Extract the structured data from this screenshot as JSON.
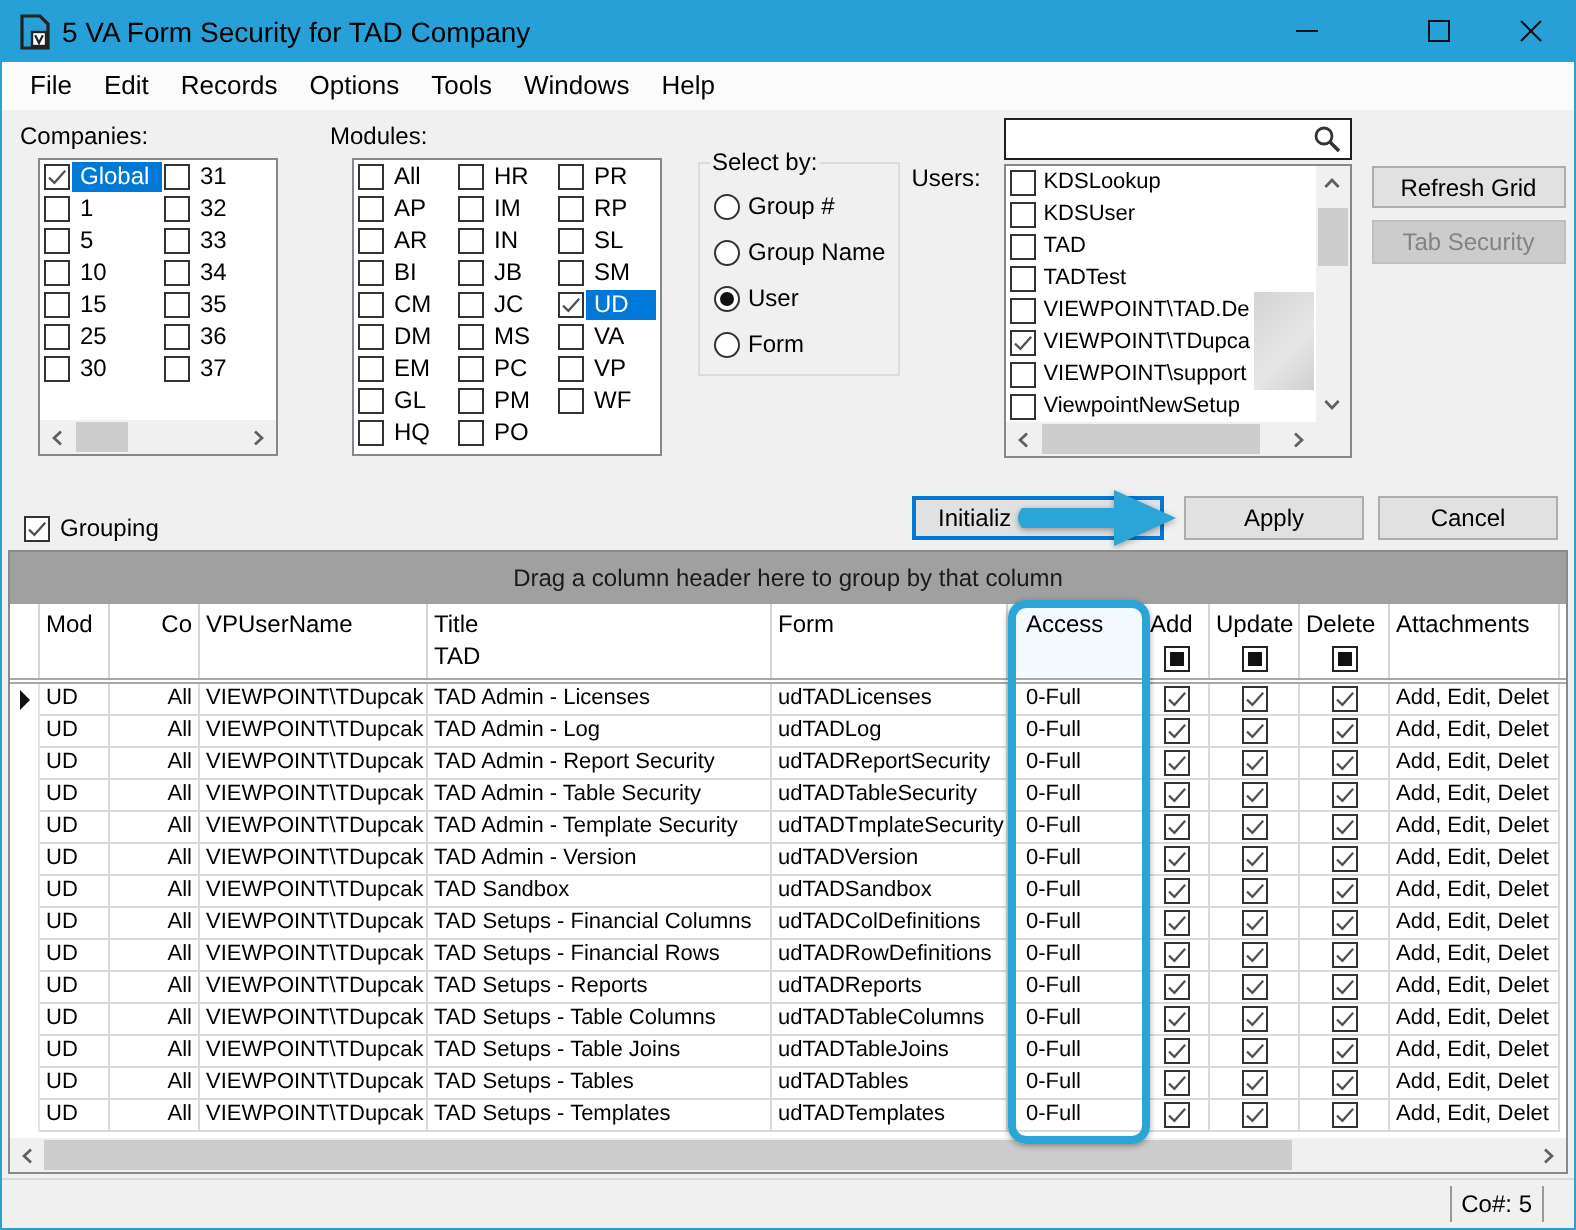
{
  "window": {
    "title": "5 VA Form Security for TAD Company"
  },
  "menu": [
    "File",
    "Edit",
    "Records",
    "Options",
    "Tools",
    "Windows",
    "Help"
  ],
  "companies": {
    "label": "Companies:",
    "items": [
      {
        "label": "Global",
        "checked": true,
        "selected": true
      },
      {
        "label": "1",
        "checked": false,
        "selected": false
      },
      {
        "label": "5",
        "checked": false,
        "selected": false
      },
      {
        "label": "10",
        "checked": false,
        "selected": false
      },
      {
        "label": "15",
        "checked": false,
        "selected": false
      },
      {
        "label": "25",
        "checked": false,
        "selected": false
      },
      {
        "label": "30",
        "checked": false,
        "selected": false
      },
      {
        "label": "31",
        "checked": false,
        "selected": false
      },
      {
        "label": "32",
        "checked": false,
        "selected": false
      },
      {
        "label": "33",
        "checked": false,
        "selected": false
      },
      {
        "label": "34",
        "checked": false,
        "selected": false
      },
      {
        "label": "35",
        "checked": false,
        "selected": false
      },
      {
        "label": "36",
        "checked": false,
        "selected": false
      },
      {
        "label": "37",
        "checked": false,
        "selected": false
      }
    ]
  },
  "modules": {
    "label": "Modules:",
    "items": [
      {
        "label": "All",
        "checked": false,
        "selected": false
      },
      {
        "label": "AP",
        "checked": false,
        "selected": false
      },
      {
        "label": "AR",
        "checked": false,
        "selected": false
      },
      {
        "label": "BI",
        "checked": false,
        "selected": false
      },
      {
        "label": "CM",
        "checked": false,
        "selected": false
      },
      {
        "label": "DM",
        "checked": false,
        "selected": false
      },
      {
        "label": "EM",
        "checked": false,
        "selected": false
      },
      {
        "label": "GL",
        "checked": false,
        "selected": false
      },
      {
        "label": "HQ",
        "checked": false,
        "selected": false
      },
      {
        "label": "HR",
        "checked": false,
        "selected": false
      },
      {
        "label": "IM",
        "checked": false,
        "selected": false
      },
      {
        "label": "IN",
        "checked": false,
        "selected": false
      },
      {
        "label": "JB",
        "checked": false,
        "selected": false
      },
      {
        "label": "JC",
        "checked": false,
        "selected": false
      },
      {
        "label": "MS",
        "checked": false,
        "selected": false
      },
      {
        "label": "PC",
        "checked": false,
        "selected": false
      },
      {
        "label": "PM",
        "checked": false,
        "selected": false
      },
      {
        "label": "PO",
        "checked": false,
        "selected": false
      },
      {
        "label": "PR",
        "checked": false,
        "selected": false
      },
      {
        "label": "RP",
        "checked": false,
        "selected": false
      },
      {
        "label": "SL",
        "checked": false,
        "selected": false
      },
      {
        "label": "SM",
        "checked": false,
        "selected": false
      },
      {
        "label": "UD",
        "checked": true,
        "selected": true
      },
      {
        "label": "VA",
        "checked": false,
        "selected": false
      },
      {
        "label": "VP",
        "checked": false,
        "selected": false
      },
      {
        "label": "WF",
        "checked": false,
        "selected": false
      }
    ]
  },
  "select_by": {
    "label": "Select by:",
    "options": [
      {
        "label": "Group #",
        "selected": false
      },
      {
        "label": "Group Name",
        "selected": false
      },
      {
        "label": "User",
        "selected": true
      },
      {
        "label": "Form",
        "selected": false
      }
    ]
  },
  "users": {
    "label": "Users:",
    "items": [
      {
        "label": "KDSLookup",
        "checked": false
      },
      {
        "label": "KDSUser",
        "checked": false
      },
      {
        "label": "TAD",
        "checked": false
      },
      {
        "label": "TADTest",
        "checked": false
      },
      {
        "label": "VIEWPOINT\\TAD.De",
        "checked": false
      },
      {
        "label": "VIEWPOINT\\TDupca",
        "checked": true
      },
      {
        "label": "VIEWPOINT\\support",
        "checked": false
      },
      {
        "label": "ViewpointNewSetup",
        "checked": false
      }
    ]
  },
  "side_buttons": [
    {
      "label": "Refresh Grid",
      "disabled": false
    },
    {
      "label": "Tab Security",
      "disabled": true
    }
  ],
  "grouping": {
    "label": "Grouping",
    "checked": true
  },
  "actions": [
    {
      "label": "Initializ",
      "focused": true
    },
    {
      "label": "Apply",
      "focused": false
    },
    {
      "label": "Cancel",
      "focused": false
    }
  ],
  "grid": {
    "group_panel": "Drag a column header here to group by that column",
    "columns": [
      {
        "label": "Mod",
        "kind": "text",
        "highlighted": false
      },
      {
        "label": "Co",
        "kind": "numeric",
        "highlighted": false
      },
      {
        "label": "VPUserName",
        "kind": "text",
        "highlighted": false
      },
      {
        "label": "Title",
        "kind": "text",
        "filter": "TAD",
        "highlighted": false
      },
      {
        "label": "Form",
        "kind": "text",
        "highlighted": false
      },
      {
        "label": "Access",
        "kind": "text",
        "highlighted": true
      },
      {
        "label": "Add",
        "kind": "check",
        "indeterminate": true,
        "highlighted": false
      },
      {
        "label": "Update",
        "kind": "check",
        "indeterminate": true,
        "highlighted": false
      },
      {
        "label": "Delete",
        "kind": "check",
        "indeterminate": true,
        "highlighted": false
      },
      {
        "label": "Attachments",
        "kind": "text",
        "highlighted": false
      }
    ],
    "rows": [
      {
        "current": true,
        "cells": [
          "UD",
          "All",
          "VIEWPOINT\\TDupcak",
          "TAD Admin - Licenses",
          "udTADLicenses",
          "0-Full",
          {
            "checked": true
          },
          {
            "checked": true
          },
          {
            "checked": true
          },
          "Add, Edit, Delet"
        ]
      },
      {
        "current": false,
        "cells": [
          "UD",
          "All",
          "VIEWPOINT\\TDupcak",
          "TAD Admin - Log",
          "udTADLog",
          "0-Full",
          {
            "checked": true
          },
          {
            "checked": true
          },
          {
            "checked": true
          },
          "Add, Edit, Delet"
        ]
      },
      {
        "current": false,
        "cells": [
          "UD",
          "All",
          "VIEWPOINT\\TDupcak",
          "TAD Admin - Report Security",
          "udTADReportSecurity",
          "0-Full",
          {
            "checked": true
          },
          {
            "checked": true
          },
          {
            "checked": true
          },
          "Add, Edit, Delet"
        ]
      },
      {
        "current": false,
        "cells": [
          "UD",
          "All",
          "VIEWPOINT\\TDupcak",
          "TAD Admin - Table Security",
          "udTADTableSecurity",
          "0-Full",
          {
            "checked": true
          },
          {
            "checked": true
          },
          {
            "checked": true
          },
          "Add, Edit, Delet"
        ]
      },
      {
        "current": false,
        "cells": [
          "UD",
          "All",
          "VIEWPOINT\\TDupcak",
          "TAD Admin - Template Security",
          "udTADTmplateSecurity",
          "0-Full",
          {
            "checked": true
          },
          {
            "checked": true
          },
          {
            "checked": true
          },
          "Add, Edit, Delet"
        ]
      },
      {
        "current": false,
        "cells": [
          "UD",
          "All",
          "VIEWPOINT\\TDupcak",
          "TAD Admin - Version",
          "udTADVersion",
          "0-Full",
          {
            "checked": true
          },
          {
            "checked": true
          },
          {
            "checked": true
          },
          "Add, Edit, Delet"
        ]
      },
      {
        "current": false,
        "cells": [
          "UD",
          "All",
          "VIEWPOINT\\TDupcak",
          "TAD Sandbox",
          "udTADSandbox",
          "0-Full",
          {
            "checked": true
          },
          {
            "checked": true
          },
          {
            "checked": true
          },
          "Add, Edit, Delet"
        ]
      },
      {
        "current": false,
        "cells": [
          "UD",
          "All",
          "VIEWPOINT\\TDupcak",
          "TAD Setups - Financial Columns",
          "udTADColDefinitions",
          "0-Full",
          {
            "checked": true
          },
          {
            "checked": true
          },
          {
            "checked": true
          },
          "Add, Edit, Delet"
        ]
      },
      {
        "current": false,
        "cells": [
          "UD",
          "All",
          "VIEWPOINT\\TDupcak",
          "TAD Setups - Financial Rows",
          "udTADRowDefinitions",
          "0-Full",
          {
            "checked": true
          },
          {
            "checked": true
          },
          {
            "checked": true
          },
          "Add, Edit, Delet"
        ]
      },
      {
        "current": false,
        "cells": [
          "UD",
          "All",
          "VIEWPOINT\\TDupcak",
          "TAD Setups - Reports",
          "udTADReports",
          "0-Full",
          {
            "checked": true
          },
          {
            "checked": true
          },
          {
            "checked": true
          },
          "Add, Edit, Delet"
        ]
      },
      {
        "current": false,
        "cells": [
          "UD",
          "All",
          "VIEWPOINT\\TDupcak",
          "TAD Setups - Table Columns",
          "udTADTableColumns",
          "0-Full",
          {
            "checked": true
          },
          {
            "checked": true
          },
          {
            "checked": true
          },
          "Add, Edit, Delet"
        ]
      },
      {
        "current": false,
        "cells": [
          "UD",
          "All",
          "VIEWPOINT\\TDupcak",
          "TAD Setups - Table Joins",
          "udTADTableJoins",
          "0-Full",
          {
            "checked": true
          },
          {
            "checked": true
          },
          {
            "checked": true
          },
          "Add, Edit, Delet"
        ]
      },
      {
        "current": false,
        "cells": [
          "UD",
          "All",
          "VIEWPOINT\\TDupcak",
          "TAD Setups - Tables",
          "udTADTables",
          "0-Full",
          {
            "checked": true
          },
          {
            "checked": true
          },
          {
            "checked": true
          },
          "Add, Edit, Delet"
        ]
      },
      {
        "current": false,
        "cells": [
          "UD",
          "All",
          "VIEWPOINT\\TDupcak",
          "TAD Setups - Templates",
          "udTADTemplates",
          "0-Full",
          {
            "checked": true
          },
          {
            "checked": true
          },
          {
            "checked": true
          },
          "Add, Edit, Delet"
        ]
      }
    ]
  },
  "status_bar": {
    "text": "Co#: 5"
  }
}
